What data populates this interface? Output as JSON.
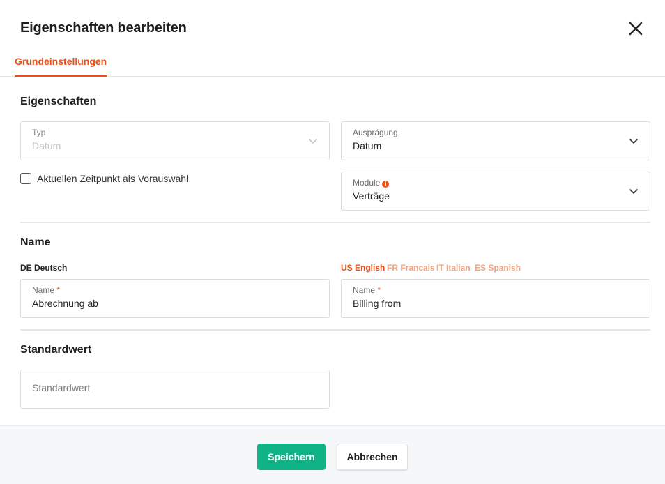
{
  "dialog": {
    "title": "Eigenschaften bearbeiten"
  },
  "tabs": [
    {
      "label": "Grundeinstellungen",
      "active": true
    }
  ],
  "properties": {
    "section_title": "Eigenschaften",
    "type": {
      "label": "Typ",
      "value": "Datum",
      "disabled": true
    },
    "variant": {
      "label": "Ausprägung",
      "value": "Datum"
    },
    "modules": {
      "label": "Module",
      "info_icon": "i",
      "value": "Verträge"
    },
    "checkbox": {
      "label": "Aktuellen Zeitpunkt als Vorauswahl",
      "checked": false
    }
  },
  "name": {
    "section_title": "Name",
    "primary_language": "DE Deutsch",
    "languages": [
      {
        "label": "US English",
        "active": true
      },
      {
        "label": "FR Francais",
        "active": false
      },
      {
        "label": "IT Italian",
        "active": false
      },
      {
        "label": "ES Spanish",
        "active": false
      }
    ],
    "de_field": {
      "label": "Name",
      "required_mark": "*",
      "value": "Abrechnung ab"
    },
    "translated_field": {
      "label": "Name",
      "required_mark": "*",
      "value": "Billing from"
    }
  },
  "default_value": {
    "section_title": "Standardwert",
    "placeholder": "Standardwert",
    "value": ""
  },
  "footer": {
    "save_label": "Speichern",
    "cancel_label": "Abbrechen"
  },
  "colors": {
    "accent": "#e8501a",
    "accent_light": "#f0a483",
    "save_button": "#10b386"
  }
}
